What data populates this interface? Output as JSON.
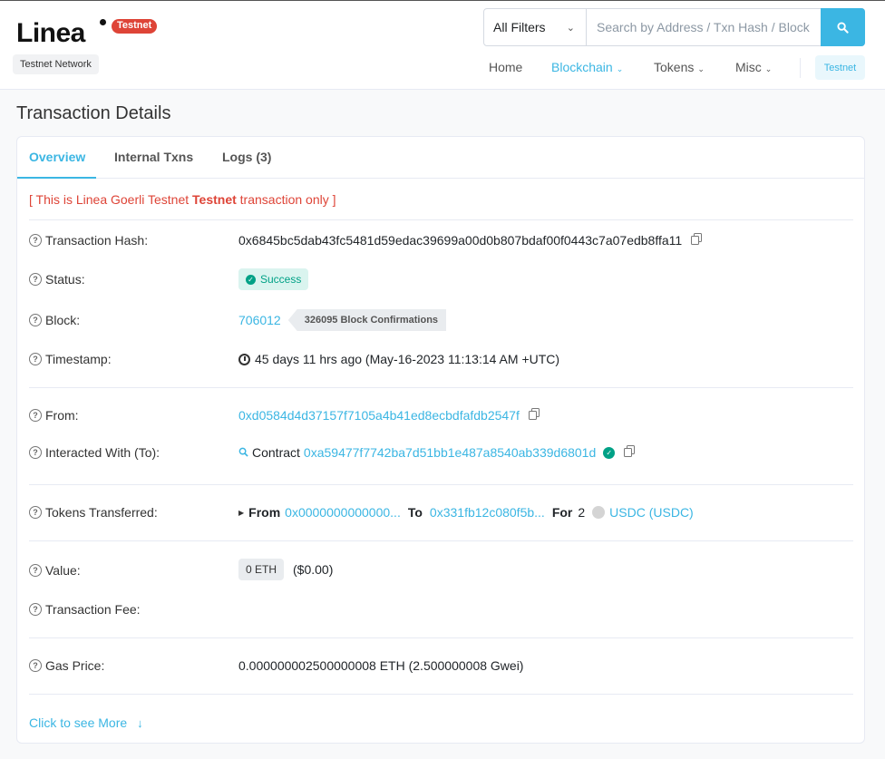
{
  "brand": {
    "logo_text": "Linea",
    "testnet_pill": "Testnet",
    "network_badge": "Testnet Network"
  },
  "search": {
    "filter_label": "All Filters",
    "placeholder": "Search by Address / Txn Hash / Block / Token / Ens"
  },
  "nav": {
    "home": "Home",
    "blockchain": "Blockchain",
    "tokens": "Tokens",
    "misc": "Misc",
    "testnet": "Testnet"
  },
  "page": {
    "title": "Transaction Details"
  },
  "tabs": {
    "overview": "Overview",
    "internal": "Internal Txns",
    "logs": "Logs (3)"
  },
  "notice": {
    "prefix": "[ This is Linea Goerli Testnet ",
    "bold": "Testnet",
    "suffix": " transaction only ]"
  },
  "rows": {
    "hash": {
      "label": "Transaction Hash:",
      "value": "0x6845bc5dab43fc5481d59edac39699a00d0b807bdaf00f0443c7a07edb8ffa11"
    },
    "status": {
      "label": "Status:",
      "value": "Success"
    },
    "block": {
      "label": "Block:",
      "value": "706012",
      "confirmations": "326095 Block Confirmations"
    },
    "timestamp": {
      "label": "Timestamp:",
      "value": "45 days 11 hrs ago (May-16-2023 11:13:14 AM +UTC)"
    },
    "from": {
      "label": "From:",
      "value": "0xd0584d4d37157f7105a4b41ed8ecbdfafdb2547f"
    },
    "to": {
      "label": "Interacted With (To):",
      "prefix": "Contract",
      "value": "0xa59477f7742ba7d51bb1e487a8540ab339d6801d"
    },
    "tokens": {
      "label": "Tokens Transferred:",
      "from_label": "From",
      "from_value": "0x0000000000000...",
      "to_label": "To",
      "to_value": "0x331fb12c080f5b...",
      "for_label": "For",
      "amount": "2",
      "token": "USDC (USDC)"
    },
    "value": {
      "label": "Value:",
      "badge": "0 ETH",
      "usd": "($0.00)"
    },
    "fee": {
      "label": "Transaction Fee:"
    },
    "gas": {
      "label": "Gas Price:",
      "value": "0.000000002500000008 ETH (2.500000008 Gwei)"
    }
  },
  "see_more": "Click to see More",
  "colors": {
    "accent": "#3bb6e3",
    "danger": "#de4437",
    "success": "#00a186"
  }
}
